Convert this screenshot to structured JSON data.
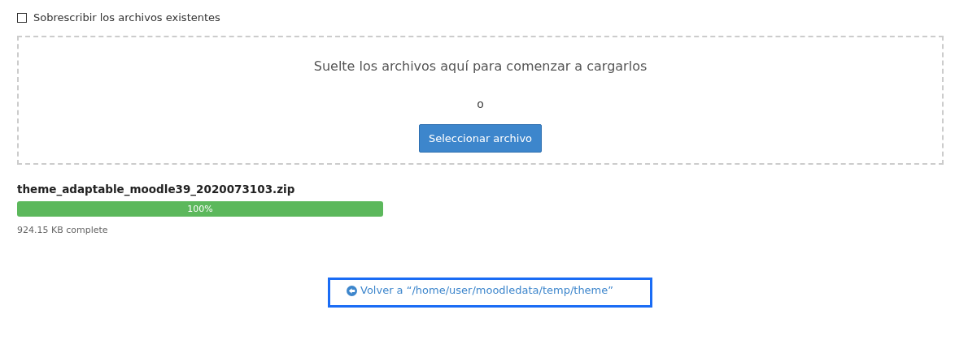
{
  "overwrite": {
    "label": "Sobrescribir los archivos existentes",
    "checked": false
  },
  "dropzone": {
    "message": "Suelte los archivos aquí para comenzar a cargarlos",
    "separator": "o",
    "button": "Seleccionar archivo"
  },
  "upload": {
    "filename": "theme_adaptable_moodle39_2020073103.zip",
    "level": 1,
    "percent": "100%",
    "status": "924.15 KB complete"
  },
  "back_link": {
    "text": "Volver a “/home/user/moodledata/temp/theme”",
    "highlighted": true
  }
}
